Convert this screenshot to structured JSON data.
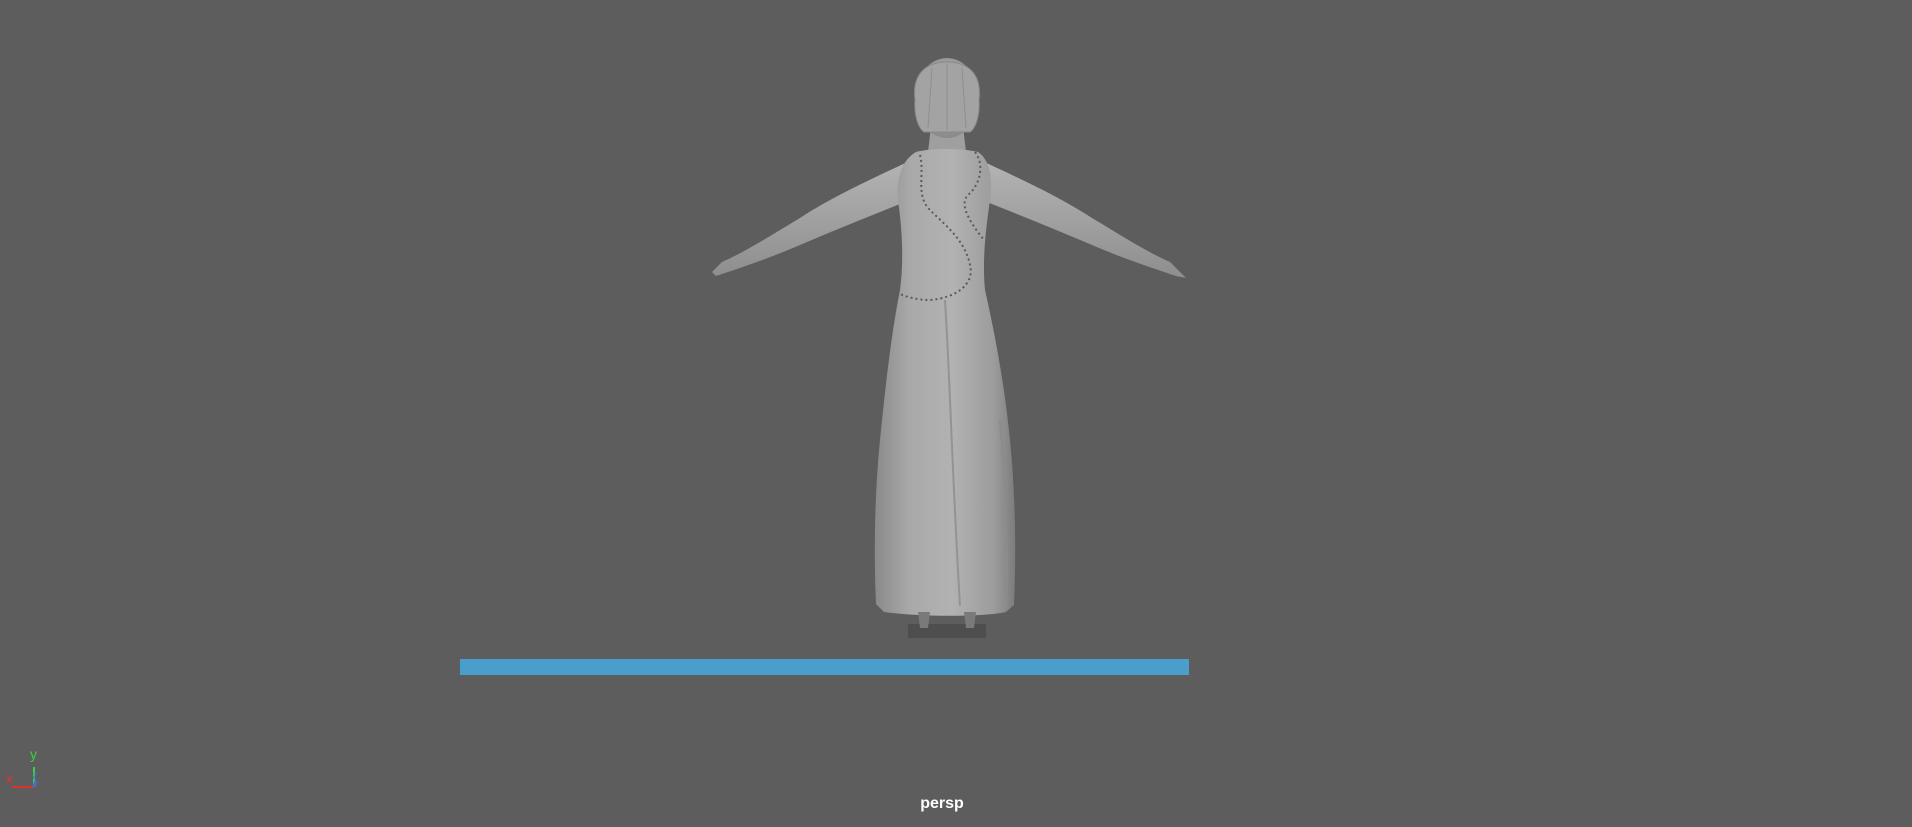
{
  "viewport": {
    "camera_label": "persp",
    "background_color": "#5d5d5d"
  },
  "progress_bar": {
    "color": "#4a9ecb",
    "fraction": 1.0
  },
  "axis_gizmo": {
    "x_label": "x",
    "y_label": "y",
    "z_label": "z",
    "x_color": "#e0322c",
    "y_color": "#3fcf3f",
    "z_color": "#3a6fd9"
  },
  "model": {
    "icon": "character-model-dress-tpose",
    "surface_color": "#a8a8a8"
  }
}
